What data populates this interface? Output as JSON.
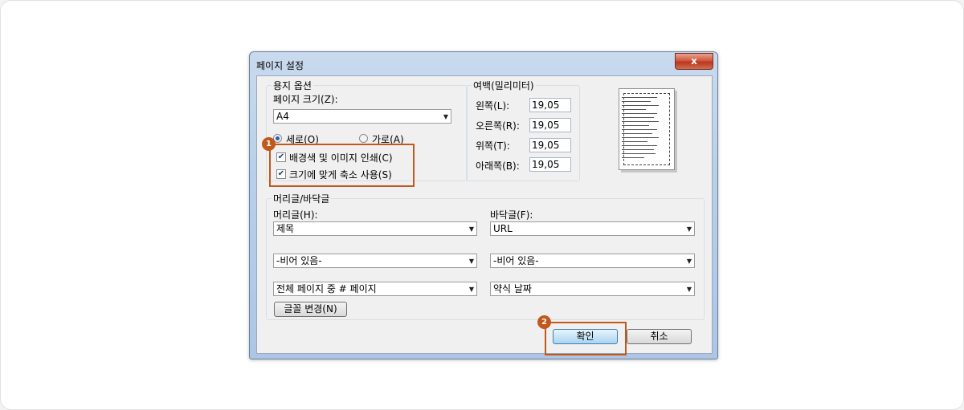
{
  "window": {
    "title": "페이지 설정",
    "close_label": "x"
  },
  "paper": {
    "group_title": "용지 옵션",
    "size_label": "페이지 크기(Z):",
    "size_value": "A4",
    "portrait_label": "세로(O)",
    "landscape_label": "가로(A)",
    "orientation_selected": "portrait",
    "print_bg_label": "배경색 및 이미지 인쇄(C)",
    "print_bg_checked": true,
    "shrink_label": "크기에 맞게 축소 사용(S)",
    "shrink_checked": true
  },
  "margins": {
    "group_title": "여백(밀리미터)",
    "left_label": "왼쪽(L):",
    "left_value": "19,05",
    "right_label": "오른쪽(R):",
    "right_value": "19,05",
    "top_label": "위쪽(T):",
    "top_value": "19,05",
    "bottom_label": "아래쪽(B):",
    "bottom_value": "19,05"
  },
  "header_footer": {
    "group_title": "머리글/바닥글",
    "header_label": "머리글(H):",
    "footer_label": "바닥글(F):",
    "header_1": "제목",
    "header_2": "-비어 있음-",
    "header_3": "전체 페이지 중 # 페이지",
    "footer_1": "URL",
    "footer_2": "-비어 있음-",
    "footer_3": "약식 날짜",
    "font_button": "글꼴 변경(N)"
  },
  "buttons": {
    "ok": "확인",
    "cancel": "취소"
  },
  "callouts": {
    "badge_1": "1",
    "badge_2": "2",
    "color": "#c2581c"
  },
  "icons": {
    "check": "✔",
    "dropdown": "▼"
  }
}
